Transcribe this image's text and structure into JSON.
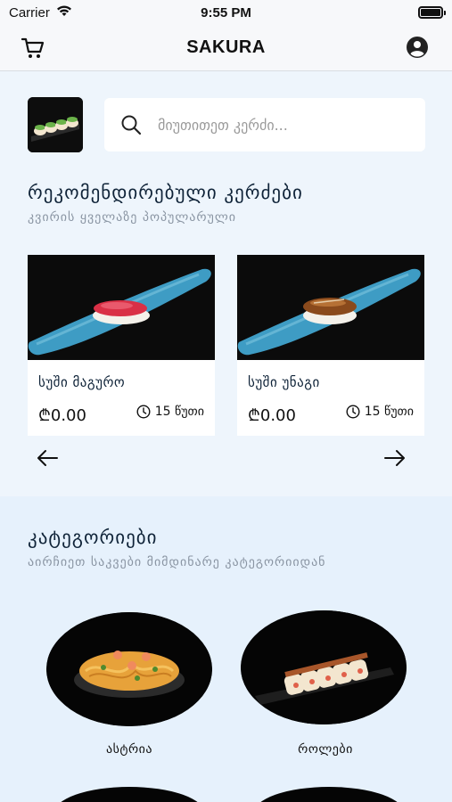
{
  "status_bar": {
    "carrier": "Carrier",
    "time": "9:55 PM"
  },
  "nav": {
    "title": "SAKURA",
    "cart_icon": "cart-icon",
    "profile_icon": "profile-icon"
  },
  "search": {
    "placeholder": "მიუთითეთ კერძი..."
  },
  "recommended": {
    "title": "რეკომენდირებული კერძები",
    "subtitle": "კვირის ყველაზე პოპულარული",
    "items": [
      {
        "name": "სუში მაგურო",
        "price": "₾0.00",
        "time": "15 წუთი"
      },
      {
        "name": "სუში უნაგი",
        "price": "₾0.00",
        "time": "15 წუთი"
      }
    ]
  },
  "categories": {
    "title": "კატეგორიები",
    "subtitle": "აირჩიეთ საკვები მიმდინარე კატეგორიიდან",
    "items": [
      {
        "label": "ასტრია"
      },
      {
        "label": "როლები"
      }
    ]
  },
  "colors": {
    "background": "#eef5fc",
    "category_bg": "#e6f1fc",
    "heading": "#0f2338",
    "plate_blue": "#3e9cc4"
  }
}
